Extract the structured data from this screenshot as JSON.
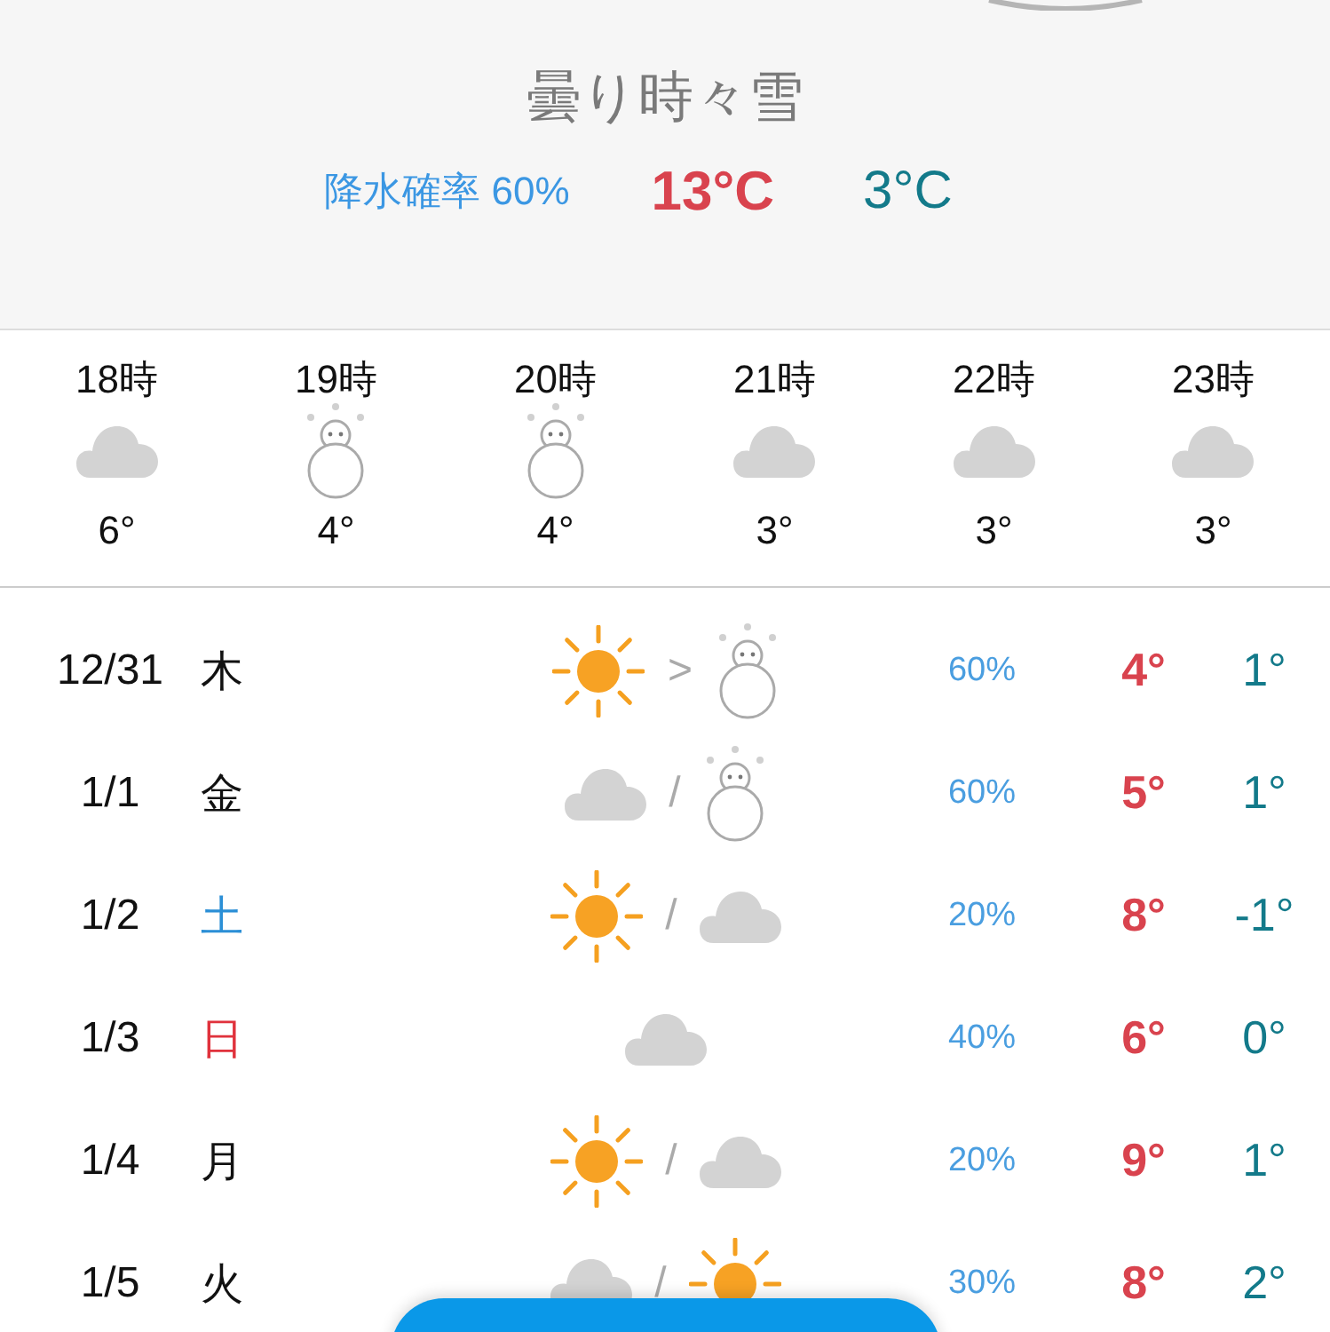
{
  "condition": "曇り時々雪",
  "precipitation": "降水確率 60%",
  "high": "13°C",
  "low": "3°C",
  "hourly": [
    {
      "time": "18時",
      "kind": "cloud",
      "temp": "6°"
    },
    {
      "time": "19時",
      "kind": "snow",
      "temp": "4°"
    },
    {
      "time": "20時",
      "kind": "snow",
      "temp": "4°"
    },
    {
      "time": "21時",
      "kind": "cloud",
      "temp": "3°"
    },
    {
      "time": "22時",
      "kind": "cloud",
      "temp": "3°"
    },
    {
      "time": "23時",
      "kind": "cloud",
      "temp": "3°"
    }
  ],
  "daily": [
    {
      "date": "12/31",
      "weekday": "木",
      "color": "#111111",
      "icons": [
        {
          "kind": "sun"
        },
        {
          "kind": "snow"
        }
      ],
      "separator": ">",
      "precip": "60%",
      "high": "4°",
      "low": "1°"
    },
    {
      "date": "1/1",
      "weekday": "金",
      "color": "#111111",
      "icons": [
        {
          "kind": "cloud"
        },
        {
          "kind": "snow"
        }
      ],
      "separator": "/",
      "precip": "60%",
      "high": "5°",
      "low": "1°"
    },
    {
      "date": "1/2",
      "weekday": "土",
      "color": "#2b8fd6",
      "icons": [
        {
          "kind": "sun"
        },
        {
          "kind": "cloud"
        }
      ],
      "separator": "/",
      "precip": "20%",
      "high": "8°",
      "low": "-1°"
    },
    {
      "date": "1/3",
      "weekday": "日",
      "color": "#e0323c",
      "icons": [
        {
          "kind": "cloud"
        }
      ],
      "precip": "40%",
      "high": "6°",
      "low": "0°"
    },
    {
      "date": "1/4",
      "weekday": "月",
      "color": "#111111",
      "icons": [
        {
          "kind": "sun"
        },
        {
          "kind": "cloud"
        }
      ],
      "separator": "/",
      "precip": "20%",
      "high": "9°",
      "low": "1°"
    },
    {
      "date": "1/5",
      "weekday": "火",
      "color": "#111111",
      "icons": [
        {
          "kind": "cloud"
        },
        {
          "kind": "sun"
        }
      ],
      "separator": "/",
      "precip": "30%",
      "high": "8°",
      "low": "2°"
    }
  ]
}
